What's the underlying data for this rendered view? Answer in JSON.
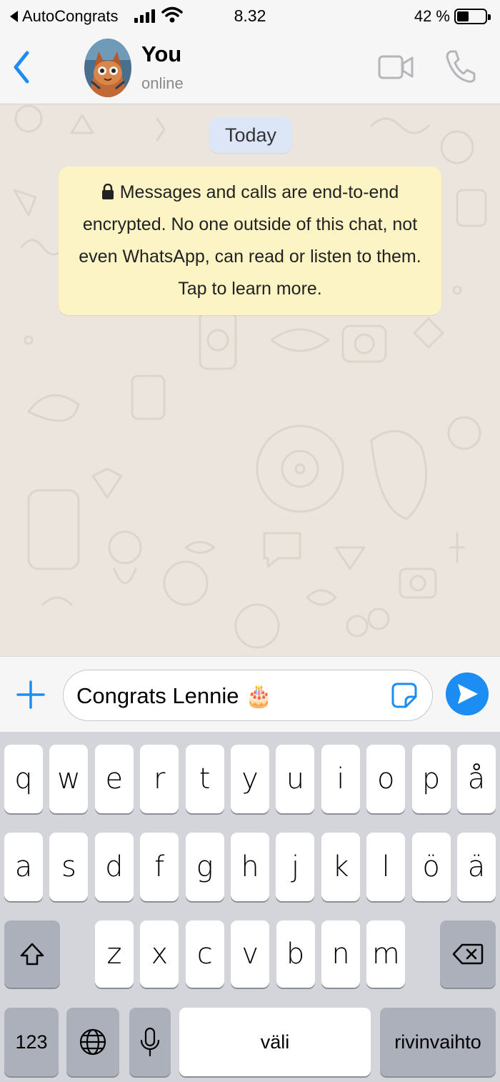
{
  "status_bar": {
    "back_app": "AutoCongrats",
    "time": "8.32",
    "battery": "42 %",
    "battery_level": 0.42
  },
  "header": {
    "contact_name": "You",
    "contact_status": "online"
  },
  "chat": {
    "date_chip": "Today",
    "encryption_notice": "Messages and calls are end-to-end encrypted. No one outside of this chat, not even WhatsApp, can read or listen to them. Tap to learn more."
  },
  "composer": {
    "message_text": "Congrats Lennie 🎂"
  },
  "keyboard": {
    "row1": [
      "q",
      "w",
      "e",
      "r",
      "t",
      "y",
      "u",
      "i",
      "o",
      "p",
      "å"
    ],
    "row2": [
      "a",
      "s",
      "d",
      "f",
      "g",
      "h",
      "j",
      "k",
      "l",
      "ö",
      "ä"
    ],
    "row3": [
      "z",
      "x",
      "c",
      "v",
      "b",
      "n",
      "m"
    ],
    "numbers_label": "123",
    "space_label": "väli",
    "return_label": "rivinvaihto"
  },
  "colors": {
    "accent": "#1c8ef3",
    "chat_bg": "#ece5dd",
    "notice_bg": "#fcf4c4",
    "date_chip_bg": "#dce6f6"
  }
}
